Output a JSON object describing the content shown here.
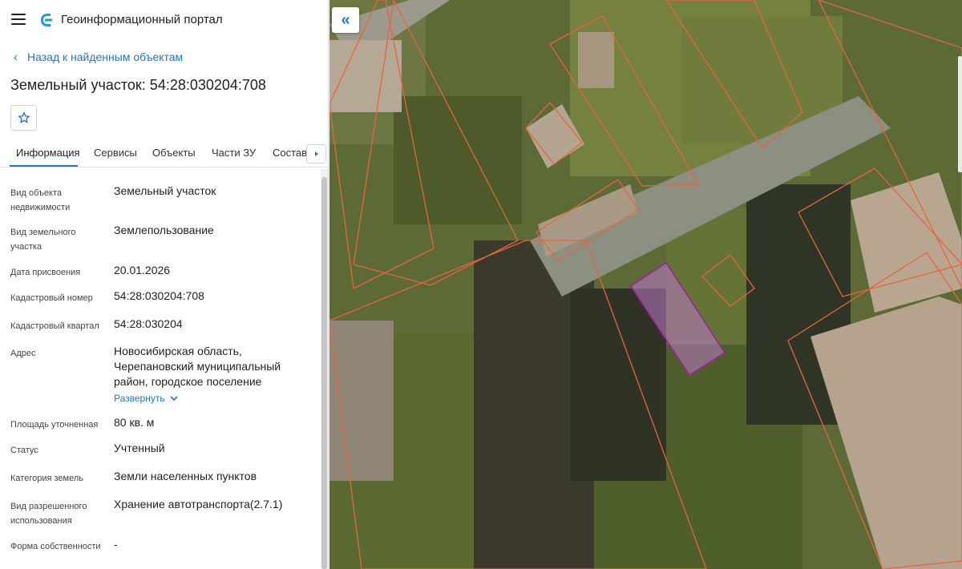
{
  "app": {
    "title": "Геоинформационный портал"
  },
  "nav": {
    "back_label": "Назад к найденным объектам"
  },
  "object": {
    "title": "Земельный участок: 54:28:030204:708"
  },
  "tabs": [
    {
      "label": "Информация"
    },
    {
      "label": "Сервисы"
    },
    {
      "label": "Объекты"
    },
    {
      "label": "Части ЗУ"
    },
    {
      "label": "Состав"
    }
  ],
  "info": {
    "rows": [
      {
        "label": "Вид объекта недвижимости",
        "value": "Земельный участок"
      },
      {
        "label": "Вид земельного участка",
        "value": "Землепользование"
      },
      {
        "label": "Дата присвоения",
        "value": "20.01.2026"
      },
      {
        "label": "Кадастровый номер",
        "value": "54:28:030204:708"
      },
      {
        "label": "Кадастровый квартал",
        "value": "54:28:030204"
      },
      {
        "label": "Адрес",
        "value": "Новосибирская область, Черепановский муниципальный район, городское поселение"
      },
      {
        "label": "Площадь уточненная",
        "value": "80 кв. м"
      },
      {
        "label": "Статус",
        "value": "Учтенный"
      },
      {
        "label": "Категория земель",
        "value": "Земли населенных пунктов"
      },
      {
        "label": "Вид разрешенного использования",
        "value": "Хранение автотранспорта(2.7.1)"
      },
      {
        "label": "Форма собственности",
        "value": "-"
      }
    ],
    "expand_label": "Развернуть"
  },
  "colors": {
    "accent": "#1e73d8",
    "parcel_border": "#e8643c",
    "selected_parcel": "#a020a0"
  },
  "icons": {
    "menu": "hamburger-icon",
    "logo": "portal-logo-icon",
    "back": "chevron-left-icon",
    "favorite": "star-icon",
    "tabs_scroll": "caret-right-icon",
    "collapse": "double-chevron-left-icon"
  }
}
